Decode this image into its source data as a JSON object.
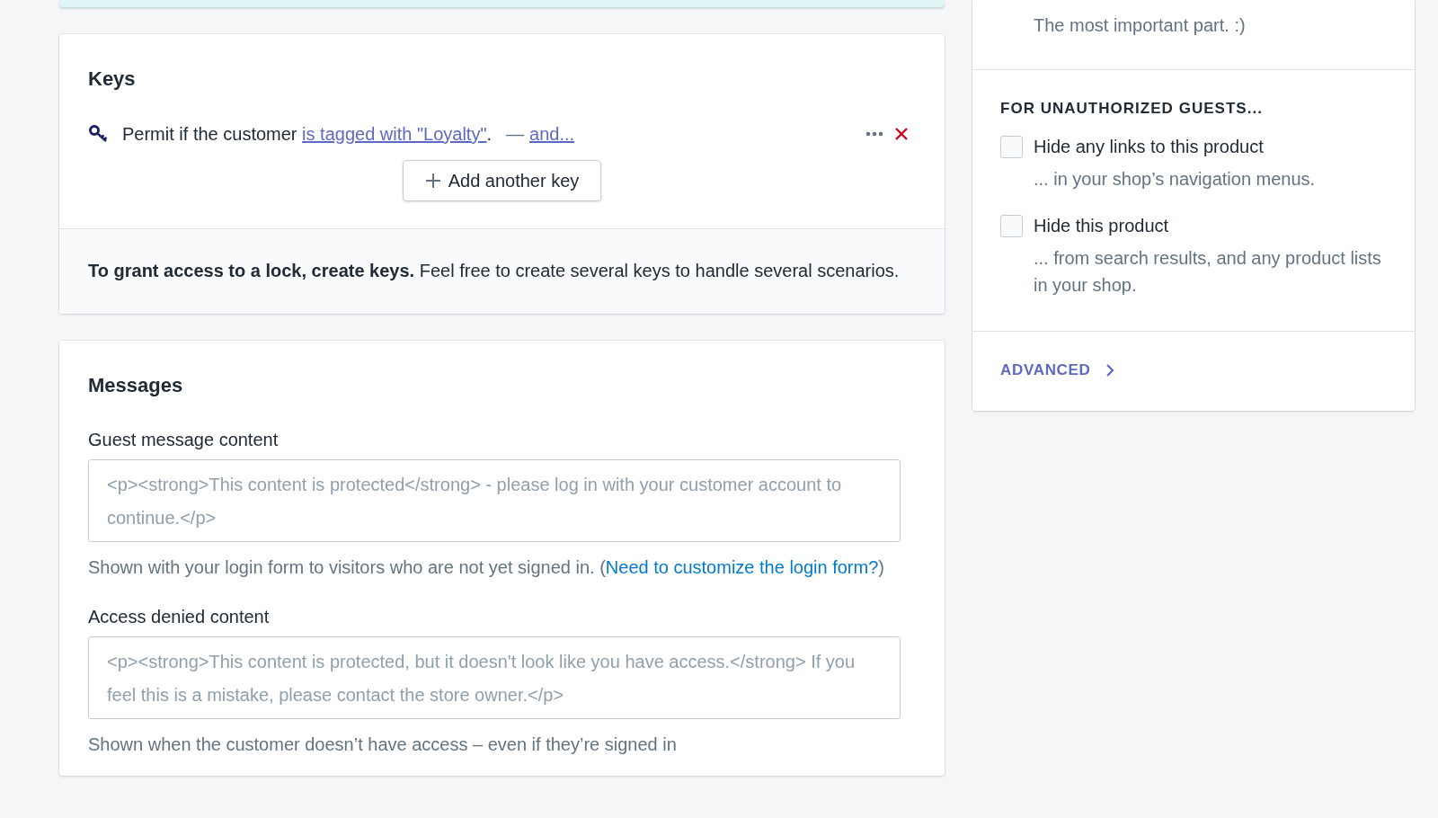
{
  "keys_card": {
    "title": "Keys",
    "keys": [
      {
        "prefix": "Permit if the customer",
        "condition": "is tagged with \"Loyalty\"",
        "suffix": ".",
        "separator": "—",
        "more": "and..."
      }
    ],
    "add_button": "Add another key",
    "footer": "**To grant access to a lock, create keys.** Feel free to create several keys to handle several scenarios."
  },
  "messages_card": {
    "title": "Messages",
    "fields": [
      {
        "label": "Guest message content",
        "placeholder": "<p><strong>This content is protected</strong> - please log in with your customer account to continue.</p>",
        "help": "Shown with your login form to visitors who are not yet signed in. (",
        "help_link": "Need to customize the login form?",
        "help_end": ")"
      },
      {
        "label": "Access denied content",
        "placeholder": "<p><strong>This content is protected, but it doesn't look like you have access.</strong> If you feel this is a mistake, please contact the store owner.</p>",
        "help": "Shown when the customer doesn’t have access – even if they’re signed in"
      }
    ]
  },
  "sidebar": {
    "top_description": "The most important part. :)",
    "section_title": "FOR UNAUTHORIZED GUESTS...",
    "options": [
      {
        "label": "Hide any links to this product",
        "description": "... in your shop’s navigation menus.",
        "checked": false
      },
      {
        "label": "Hide this product",
        "description": "... from search results, and any product lists in your shop.",
        "checked": false
      }
    ],
    "advanced_link": "ADVANCED"
  }
}
